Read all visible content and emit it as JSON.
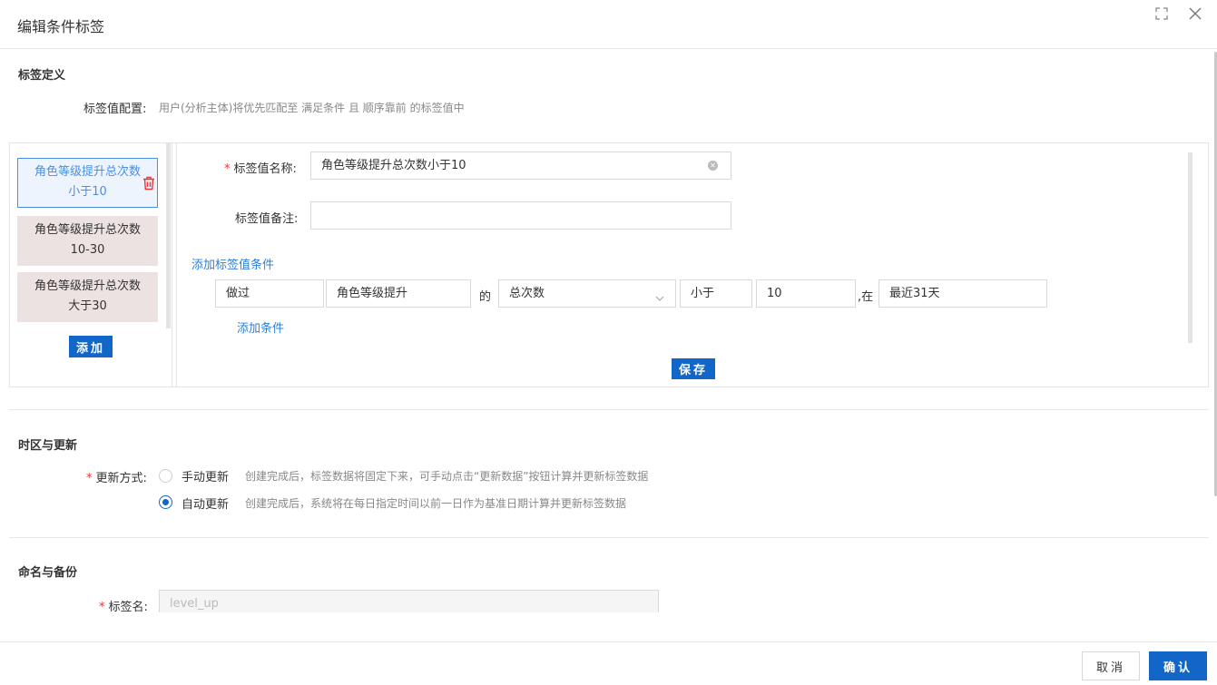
{
  "dialog": {
    "title": "编辑条件标签",
    "expand_icon": "expand-icon",
    "close_icon": "close-icon"
  },
  "definition": {
    "section_title": "标签定义",
    "config_label": "标签值配置:",
    "config_hint": "用户(分析主体)将优先匹配至 满足条件 且 顺序靠前 的标签值中",
    "tag_values": [
      {
        "label": "角色等级提升总次数小于10",
        "active": true
      },
      {
        "label": "角色等级提升总次数10-30",
        "active": false
      },
      {
        "label": "角色等级提升总次数大于30",
        "active": false
      }
    ],
    "delete_icon": "trash-icon",
    "add_button": "添加",
    "editor": {
      "name_label": "标签值名称:",
      "name_value": "角色等级提升总次数小于10",
      "note_label": "标签值备注:",
      "note_value": "",
      "add_value_condition_link": "添加标签值条件",
      "condition": {
        "action": "做过",
        "event": "角色等级提升",
        "of_text": "的",
        "metric": "总次数",
        "operator": "小于",
        "value": "10",
        "in_text": ",在",
        "period": "最近31天"
      },
      "add_condition_link": "添加条件",
      "save_button": "保存"
    }
  },
  "timezone": {
    "section_title": "时区与更新",
    "update_label": "更新方式:",
    "options": [
      {
        "label": "手动更新",
        "hint": "创建完成后，标签数据将固定下来，可手动点击“更新数据”按钮计算并更新标签数据",
        "checked": false
      },
      {
        "label": "自动更新",
        "hint": "创建完成后，系统将在每日指定时间以前一日作为基准日期计算并更新标签数据",
        "checked": true
      }
    ]
  },
  "naming": {
    "section_title": "命名与备份",
    "name_label": "标签名:",
    "name_placeholder": "level_up"
  },
  "footer": {
    "cancel_button": "取消",
    "confirm_button": "确认"
  },
  "colors": {
    "primary": "#1166c8",
    "link": "#2f7fd6",
    "active_item_border": "#4a8ee8",
    "item_bg": "#ede2e2",
    "required": "#e33",
    "delete_icon": "#e33"
  }
}
